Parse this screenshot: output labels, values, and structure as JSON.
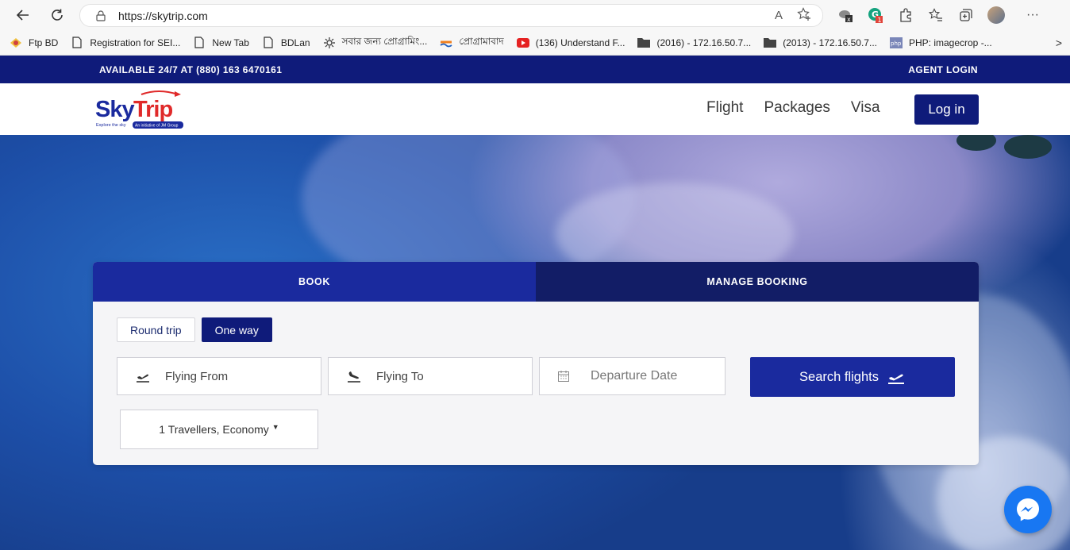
{
  "browser": {
    "url": "https://skytrip.com",
    "read_aloud_label": "A",
    "more_label": "···"
  },
  "bookmarks": [
    {
      "label": "Ftp BD",
      "icon": "ftp-icon"
    },
    {
      "label": "Registration for SEI...",
      "icon": "page-icon"
    },
    {
      "label": "New Tab",
      "icon": "page-icon"
    },
    {
      "label": "BDLan",
      "icon": "page-icon"
    },
    {
      "label": "সবার জন্য প্রোগ্রামিং...",
      "icon": "gear-icon"
    },
    {
      "label": "প্রোগ্রামাবাদ",
      "icon": "wave-icon"
    },
    {
      "label": "(136) Understand F...",
      "icon": "youtube-icon"
    },
    {
      "label": "(2016) - 172.16.50.7...",
      "icon": "folder-icon"
    },
    {
      "label": "(2013) - 172.16.50.7...",
      "icon": "folder-icon"
    },
    {
      "label": "PHP: imagecrop -...",
      "icon": "php-icon"
    }
  ],
  "bookmarks_more": ">",
  "topbar": {
    "availability": "AVAILABLE 24/7 AT (880) 163 6470161",
    "agent_login": "AGENT LOGIN"
  },
  "header": {
    "logo_text": "SkyTrip",
    "logo_tagline": "Explore the sky",
    "logo_badge": "An initiative of JM Group",
    "nav": [
      "Flight",
      "Packages",
      "Visa"
    ],
    "login": "Log in"
  },
  "booking": {
    "tabs": [
      "BOOK",
      "MANAGE BOOKING"
    ],
    "trip_types": [
      "Round trip",
      "One way"
    ],
    "selected_trip_type": "One way",
    "from_placeholder": "Flying From",
    "to_placeholder": "Flying To",
    "date_placeholder": "Departure Date",
    "search_label": "Search flights",
    "travellers": "1 Travellers, Economy"
  },
  "colors": {
    "primary": "#0f1b7a",
    "book_tab": "#1a2a9e",
    "manage_tab": "#121d66",
    "messenger": "#1877f2"
  }
}
